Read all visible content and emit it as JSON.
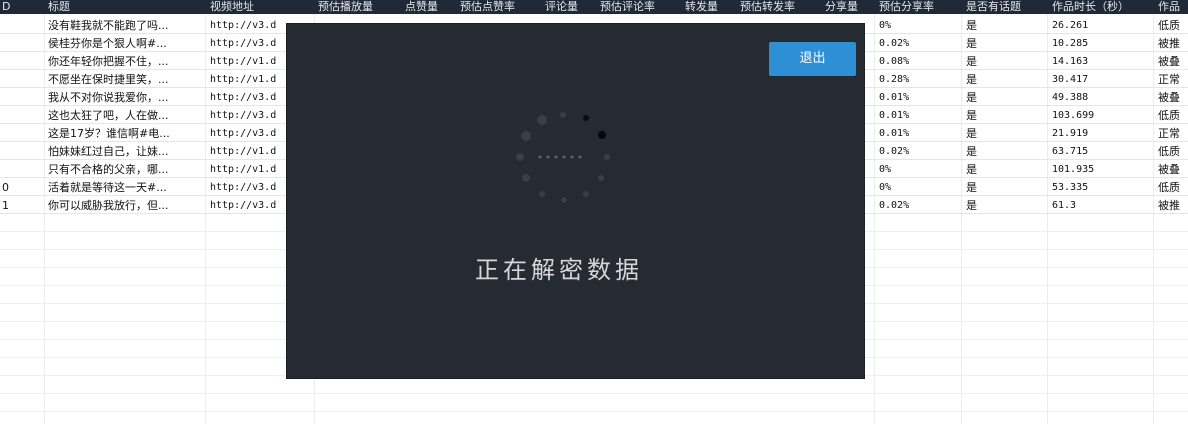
{
  "table": {
    "headers": [
      "D",
      "标题",
      "视频地址",
      "预估播放量",
      "点赞量",
      "预估点赞率",
      "评论量",
      "预估评论率",
      "转发量",
      "预估转发率",
      "分享量",
      "预估分享率",
      "是否有话题",
      "作品时长（秒）",
      "作品"
    ],
    "rows": [
      {
        "id": "",
        "title": "没有鞋我就不能跑了吗...",
        "url": "http://v3.d",
        "share_rate": "0%",
        "topic": "是",
        "duration": "26.261",
        "status": "低质"
      },
      {
        "id": "",
        "title": "侯桂芬你是个狠人啊#...",
        "url": "http://v3.d",
        "share_rate": "0.02%",
        "topic": "是",
        "duration": "10.285",
        "status": "被推"
      },
      {
        "id": "",
        "title": "你还年轻你把握不住，...",
        "url": "http://v1.d",
        "share_rate": "0.08%",
        "topic": "是",
        "duration": "14.163",
        "status": "被叠"
      },
      {
        "id": "",
        "title": "不愿坐在保时捷里笑，...",
        "url": "http://v1.d",
        "share_rate": "0.28%",
        "topic": "是",
        "duration": "30.417",
        "status": "正常"
      },
      {
        "id": "",
        "title": "我从不对你说我爱你，...",
        "url": "http://v3.d",
        "share_rate": "0.01%",
        "topic": "是",
        "duration": "49.388",
        "status": "被叠"
      },
      {
        "id": "",
        "title": "这也太狂了吧，人在做...",
        "url": "http://v3.d",
        "share_rate": "0.01%",
        "topic": "是",
        "duration": "103.699",
        "status": "低质"
      },
      {
        "id": "",
        "title": "这是17岁？谁信啊#电...",
        "url": "http://v3.d",
        "share_rate": "0.01%",
        "topic": "是",
        "duration": "21.919",
        "status": "正常"
      },
      {
        "id": "",
        "title": "怕妹妹红过自己，让妹...",
        "url": "http://v1.d",
        "share_rate": "0.02%",
        "topic": "是",
        "duration": "63.715",
        "status": "低质"
      },
      {
        "id": "",
        "title": "只有不合格的父亲，哪...",
        "url": "http://v1.d",
        "share_rate": "0%",
        "topic": "是",
        "duration": "101.935",
        "status": "被叠"
      },
      {
        "id": "0",
        "title": "活着就是等待这一天#...",
        "url": "http://v3.d",
        "share_rate": "0%",
        "topic": "是",
        "duration": "53.335",
        "status": "低质"
      },
      {
        "id": "1",
        "title": "你可以威胁我放行，但...",
        "url": "http://v3.d",
        "share_rate": "0.02%",
        "topic": "是",
        "duration": "61.3",
        "status": "被推"
      }
    ]
  },
  "dialog": {
    "exit_label": "退出",
    "message": "正在解密数据",
    "spinner_icon": "loading-spinner-icon"
  },
  "colors": {
    "header_bg": "#1f2937",
    "dialog_bg": "#262b33",
    "button_bg": "#2f8fd5"
  }
}
